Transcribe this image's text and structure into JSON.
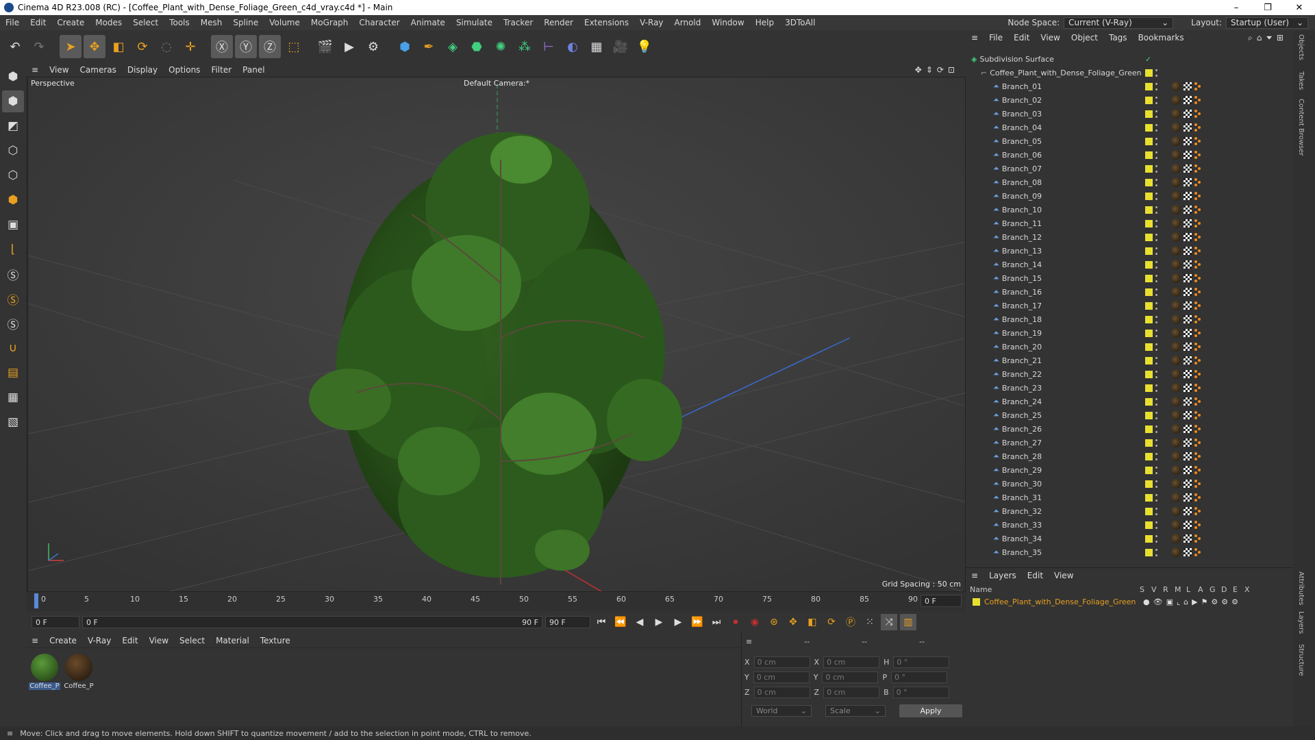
{
  "window": {
    "title": "Cinema 4D R23.008 (RC) - [Coffee_Plant_with_Dense_Foliage_Green_c4d_vray.c4d *] - Main"
  },
  "menu": [
    "File",
    "Edit",
    "Create",
    "Modes",
    "Select",
    "Tools",
    "Mesh",
    "Spline",
    "Volume",
    "MoGraph",
    "Character",
    "Animate",
    "Simulate",
    "Tracker",
    "Render",
    "Extensions",
    "V-Ray",
    "Arnold",
    "Window",
    "Help",
    "3DToAll"
  ],
  "node_space": {
    "label": "Node Space:",
    "value": "Current (V-Ray)"
  },
  "layout": {
    "label": "Layout:",
    "value": "Startup (User)"
  },
  "viewport_menu": [
    "View",
    "Cameras",
    "Display",
    "Options",
    "Filter",
    "Panel"
  ],
  "viewport": {
    "name": "Perspective",
    "camera": "Default Camera:*",
    "grid_spacing": "Grid Spacing : 50 cm"
  },
  "timeline": {
    "ticks": [
      "0",
      "5",
      "10",
      "15",
      "20",
      "25",
      "30",
      "35",
      "40",
      "45",
      "50",
      "55",
      "60",
      "65",
      "70",
      "75",
      "80",
      "85",
      "90"
    ],
    "current_frame": "0 F"
  },
  "transport": {
    "start": "0 F",
    "range_start": "0 F",
    "range_end": "90 F",
    "end": "90 F"
  },
  "material_menu": [
    "Create",
    "V-Ray",
    "Edit",
    "View",
    "Select",
    "Material",
    "Texture"
  ],
  "materials": [
    {
      "name": "Coffee_P"
    },
    {
      "name": "Coffee_P"
    }
  ],
  "coords": {
    "headers": [
      "--",
      "--",
      "--"
    ],
    "rows": [
      {
        "a": "X",
        "av": "0 cm",
        "b": "X",
        "bv": "0 cm",
        "c": "H",
        "cv": "0 °"
      },
      {
        "a": "Y",
        "av": "0 cm",
        "b": "Y",
        "bv": "0 cm",
        "c": "P",
        "cv": "0 °"
      },
      {
        "a": "Z",
        "av": "0 cm",
        "b": "Z",
        "bv": "0 cm",
        "c": "B",
        "cv": "0 °"
      }
    ],
    "world": "World",
    "scale": "Scale",
    "apply": "Apply"
  },
  "objects_menu": [
    "File",
    "Edit",
    "View",
    "Object",
    "Tags",
    "Bookmarks"
  ],
  "objects": {
    "root": "Subdivision Surface",
    "group": "Coffee_Plant_with_Dense_Foliage_Green",
    "branches": [
      "Branch_01",
      "Branch_02",
      "Branch_03",
      "Branch_04",
      "Branch_05",
      "Branch_06",
      "Branch_07",
      "Branch_08",
      "Branch_09",
      "Branch_10",
      "Branch_11",
      "Branch_12",
      "Branch_13",
      "Branch_14",
      "Branch_15",
      "Branch_16",
      "Branch_17",
      "Branch_18",
      "Branch_19",
      "Branch_20",
      "Branch_21",
      "Branch_22",
      "Branch_23",
      "Branch_24",
      "Branch_25",
      "Branch_26",
      "Branch_27",
      "Branch_28",
      "Branch_29",
      "Branch_30",
      "Branch_31",
      "Branch_32",
      "Branch_33",
      "Branch_34",
      "Branch_35"
    ]
  },
  "layers_menu": [
    "Layers",
    "Edit",
    "View"
  ],
  "layers": {
    "cols": [
      "Name",
      "S",
      "V",
      "R",
      "M",
      "L",
      "A",
      "G",
      "D",
      "E",
      "X"
    ],
    "name": "Coffee_Plant_with_Dense_Foliage_Green"
  },
  "side_tabs": [
    "Objects",
    "Takes",
    "Content Browser",
    "Attributes",
    "Layers",
    "Structure"
  ],
  "status": "Move: Click and drag to move elements. Hold down SHIFT to quantize movement / add to the selection in point mode, CTRL to remove.",
  "colors": {
    "accent": "#e8a020",
    "leaf": "#3f7a2a",
    "layer": "#e8e030"
  }
}
